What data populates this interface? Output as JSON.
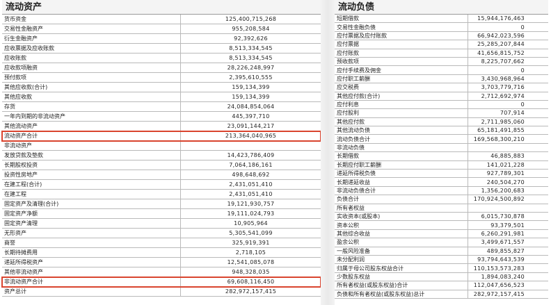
{
  "left_panel": {
    "title": "流动资产",
    "rows": [
      {
        "label": "货币资金",
        "value": "125,400,715,268"
      },
      {
        "label": "交易性金融资产",
        "value": "955,208,584"
      },
      {
        "label": "衍生金融资产",
        "value": "92,392,626"
      },
      {
        "label": "应收票据及应收账款",
        "value": "8,513,334,545"
      },
      {
        "label": "应收账款",
        "value": "8,513,334,545"
      },
      {
        "label": "应收款项融资",
        "value": "28,226,248,997"
      },
      {
        "label": "预付款项",
        "value": "2,395,610,555"
      },
      {
        "label": "其他应收款(合计)",
        "value": "159,134,399"
      },
      {
        "label": "其他应收款",
        "value": "159,134,399"
      },
      {
        "label": "存货",
        "value": "24,084,854,064"
      },
      {
        "label": "一年内到期的非流动资产",
        "value": "445,397,710"
      },
      {
        "label": "其他流动资产",
        "value": "23,091,144,217"
      },
      {
        "label": "流动资产合计",
        "value": "213,364,040,965",
        "highlight": true
      },
      {
        "label": "非流动资产",
        "value": ""
      },
      {
        "label": "发放贷款及垫款",
        "value": "14,423,786,409"
      },
      {
        "label": "长期股权投资",
        "value": "7,064,186,161"
      },
      {
        "label": "投资性房地产",
        "value": "498,648,692"
      },
      {
        "label": "在建工程(合计)",
        "value": "2,431,051,410"
      },
      {
        "label": "在建工程",
        "value": "2,431,051,410"
      },
      {
        "label": "固定资产及清理(合计)",
        "value": "19,121,930,757"
      },
      {
        "label": "固定资产净额",
        "value": "19,111,024,793"
      },
      {
        "label": "固定资产清理",
        "value": "10,905,964"
      },
      {
        "label": "无形资产",
        "value": "5,305,541,099"
      },
      {
        "label": "商誉",
        "value": "325,919,391"
      },
      {
        "label": "长期待摊费用",
        "value": "2,718,105"
      },
      {
        "label": "递延所得税资产",
        "value": "12,541,085,078"
      },
      {
        "label": "其他非流动资产",
        "value": "948,328,035"
      },
      {
        "label": "非流动资产合计",
        "value": "69,608,116,450",
        "highlight": true
      },
      {
        "label": "资产总计",
        "value": "282,972,157,415"
      }
    ]
  },
  "right_panel": {
    "title": "流动负债",
    "rows": [
      {
        "label": "短期借款",
        "value": "15,944,176,463"
      },
      {
        "label": "交易性金融负债",
        "value": "0"
      },
      {
        "label": "应付票据及应付账款",
        "value": "66,942,023,596"
      },
      {
        "label": "应付票据",
        "value": "25,285,207,844"
      },
      {
        "label": "应付账款",
        "value": "41,656,815,752"
      },
      {
        "label": "预收款项",
        "value": "8,225,707,662"
      },
      {
        "label": "应付手续费及佣金",
        "value": "0"
      },
      {
        "label": "应付职工薪酬",
        "value": "3,430,968,964"
      },
      {
        "label": "应交税费",
        "value": "3,703,779,716"
      },
      {
        "label": "其他应付款(合计)",
        "value": "2,712,692,974"
      },
      {
        "label": "应付利息",
        "value": "0"
      },
      {
        "label": "应付股利",
        "value": "707,914"
      },
      {
        "label": "其他应付款",
        "value": "2,711,985,060"
      },
      {
        "label": "其他流动负债",
        "value": "65,181,491,855"
      },
      {
        "label": "流动负债合计",
        "value": "169,568,300,210"
      },
      {
        "label": "非流动负债",
        "value": ""
      },
      {
        "label": "长期借款",
        "value": "46,885,883"
      },
      {
        "label": "长期应付职工薪酬",
        "value": "141,021,228"
      },
      {
        "label": "递延所得税负债",
        "value": "927,789,301"
      },
      {
        "label": "长期递延收益",
        "value": "240,504,270"
      },
      {
        "label": "非流动负债合计",
        "value": "1,356,200,683"
      },
      {
        "label": "负债合计",
        "value": "170,924,500,892"
      },
      {
        "label": "所有者权益",
        "value": ""
      },
      {
        "label": "实收资本(或股本)",
        "value": "6,015,730,878"
      },
      {
        "label": "资本公积",
        "value": "93,379,501"
      },
      {
        "label": "其他综合收益",
        "value": "6,260,291,981"
      },
      {
        "label": "盈余公积",
        "value": "3,499,671,557"
      },
      {
        "label": "一般风险准备",
        "value": "489,855,827"
      },
      {
        "label": "未分配利润",
        "value": "93,794,643,539"
      },
      {
        "label": "归属于母公司股东权益合计",
        "value": "110,153,573,283"
      },
      {
        "label": "少数股东权益",
        "value": "1,894,083,240"
      },
      {
        "label": "所有者权益(或股东权益)合计",
        "value": "112,047,656,523"
      },
      {
        "label": "负债和所有者权益(或股东权益)总计",
        "value": "282,972,157,415"
      }
    ]
  },
  "colors": {
    "highlight_border": "#d9442e",
    "grid_line": "#b9b9b9"
  }
}
